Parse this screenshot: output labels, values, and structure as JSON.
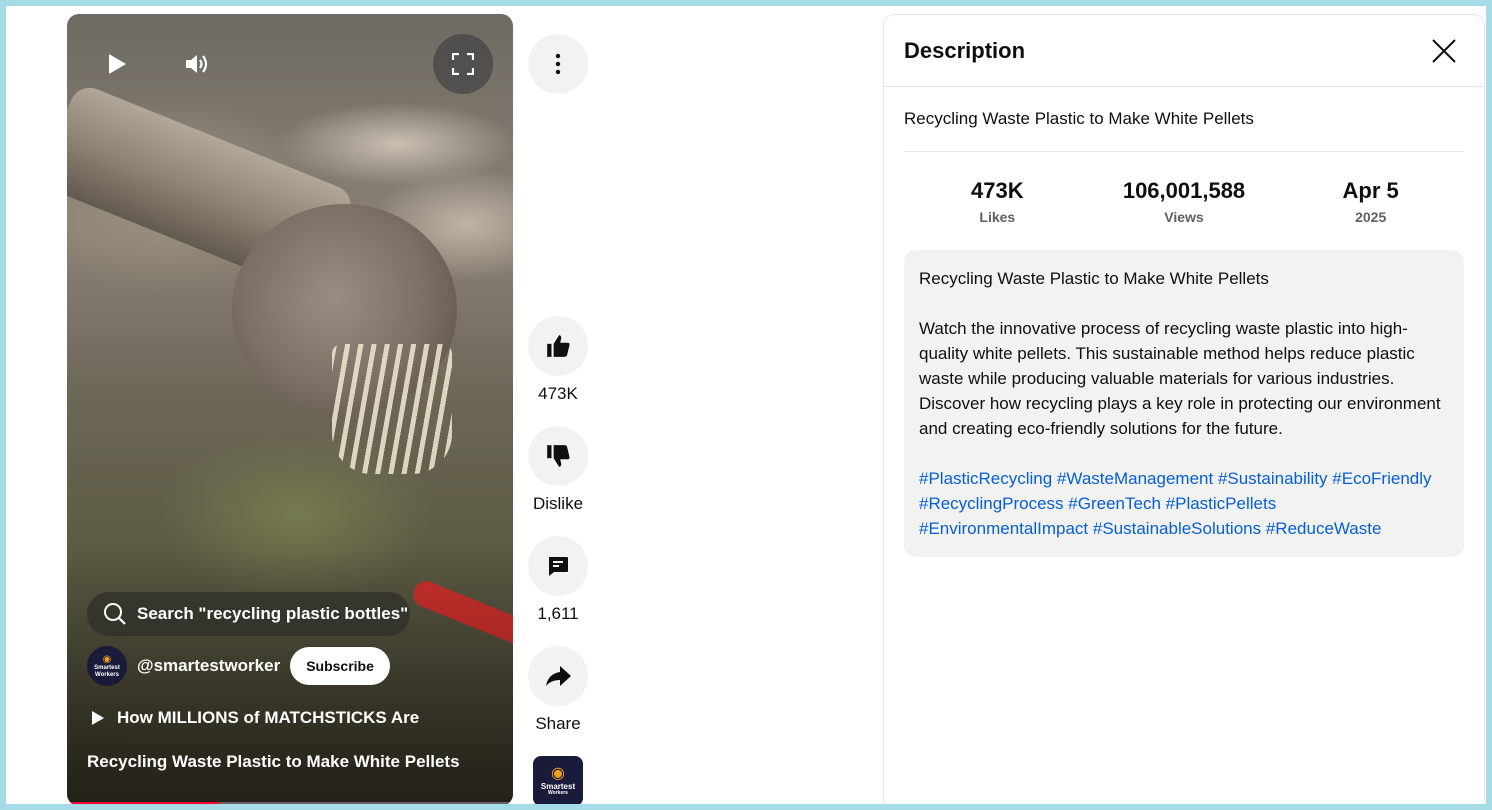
{
  "player": {
    "search_label": "Search \"recycling plastic bottles\"",
    "channel_handle": "@smartestworker",
    "avatar_text": "Smartest",
    "avatar_subtext": "Workers",
    "subscribe_label": "Subscribe",
    "related_video": "How MILLIONS of MATCHSTICKS Are",
    "video_title": "Recycling Waste Plastic to Make White Pellets",
    "progress_fraction": 0.34,
    "progress_color": "#ff0033"
  },
  "actions": {
    "like_count": "473K",
    "dislike_label": "Dislike",
    "comment_count": "1,611",
    "share_label": "Share",
    "channel_thumb_text": "Smartest",
    "channel_thumb_subtext": "Workers"
  },
  "description": {
    "heading": "Description",
    "title": "Recycling Waste Plastic to Make White Pellets",
    "stats": [
      {
        "value": "473K",
        "label": "Likes"
      },
      {
        "value": "106,001,588",
        "label": "Views"
      },
      {
        "value": "Apr 5",
        "label": "2025"
      }
    ],
    "body_title": "Recycling Waste Plastic to Make White Pellets",
    "body_text": "Watch the innovative process of recycling waste plastic into high-quality white pellets. This sustainable method helps reduce plastic waste while producing valuable materials for various industries. Discover how recycling plays a key role in protecting our environment and creating eco-friendly solutions for the future.",
    "hashtags": [
      "#PlasticRecycling",
      "#WasteManagement",
      "#Sustainability",
      "#EcoFriendly",
      "#RecyclingProcess",
      "#GreenTech",
      "#PlasticPellets",
      "#EnvironmentalImpact",
      "#SustainableSolutions",
      "#ReduceWaste"
    ],
    "link_color": "#065fd4"
  }
}
